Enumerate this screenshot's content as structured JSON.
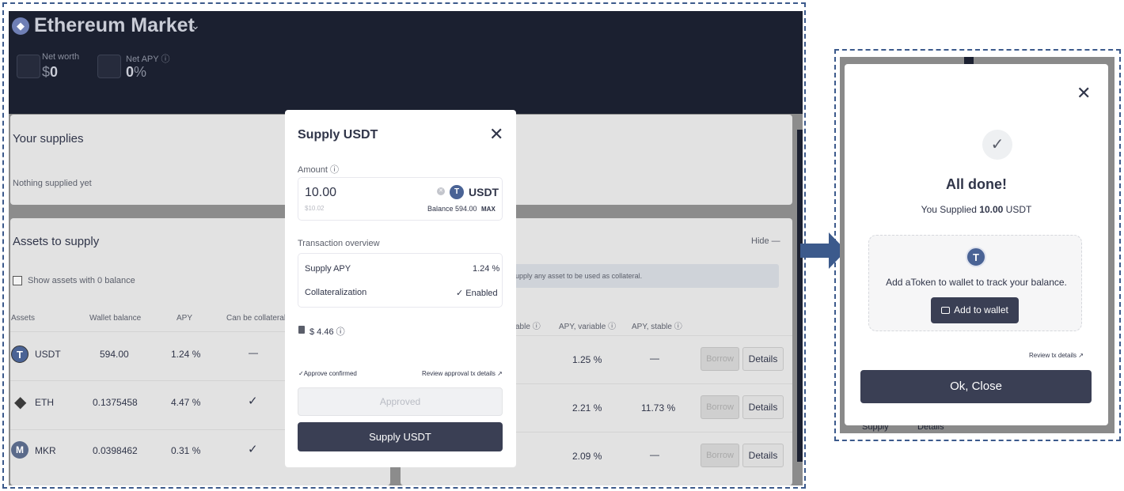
{
  "colors": {
    "dark_header": "#1b2030",
    "button_dark": "#3a3f54",
    "frame": "#3c5a8c",
    "arrow": "#3c5a8c",
    "usdt": "#4a6395",
    "eth": "#3b3b3b",
    "mkr": "#5a6a8a"
  },
  "market": {
    "title": "Ethereum Market",
    "net_worth_label": "Net worth",
    "net_worth_value": "0",
    "net_worth_prefix": "$",
    "net_apy_label": "Net APY",
    "net_apy_value": "0",
    "net_apy_unit": "%"
  },
  "supplies": {
    "title": "Your supplies",
    "empty": "Nothing supplied yet"
  },
  "assets_to_supply": {
    "title": "Assets to supply",
    "show_zero": "Show assets with 0 balance",
    "hide": "Hide —",
    "columns": [
      "Assets",
      "Wallet balance",
      "APY",
      "Can be collateral"
    ],
    "rows": [
      {
        "symbol": "USDT",
        "balance": "594.00",
        "apy": "1.24 %",
        "collateral": "—",
        "icon": "T"
      },
      {
        "symbol": "ETH",
        "balance": "0.1375458",
        "apy": "4.47 %",
        "collateral": "✓",
        "icon": "◆"
      },
      {
        "symbol": "MKR",
        "balance": "0.0398462",
        "apy": "0.31 %",
        "collateral": "✓",
        "icon": "M"
      }
    ]
  },
  "borrow": {
    "notice": "upply any asset to be used as collateral.",
    "columns": [
      "able",
      "APY, variable",
      "APY, stable"
    ],
    "rows": [
      {
        "variable": "1.25 %",
        "stable": "—",
        "borrow": "Borrow",
        "details": "Details"
      },
      {
        "variable": "2.21 %",
        "stable": "11.73 %",
        "borrow": "Borrow",
        "details": "Details"
      },
      {
        "variable": "2.09 %",
        "stable": "—",
        "borrow": "Borrow",
        "details": "Details"
      }
    ]
  },
  "supply_modal": {
    "title": "Supply USDT",
    "amount_label": "Amount",
    "amount_value": "10.00",
    "amount_usd": "$10.02",
    "token": "USDT",
    "balance_text": "Balance 594.00",
    "max": "MAX",
    "overview_label": "Transaction overview",
    "supply_apy_label": "Supply APY",
    "supply_apy_value": "1.24 %",
    "collateral_label": "Collateralization",
    "collateral_value": "Enabled",
    "gas": "$ 4.46",
    "approve_confirmed": "Approve confirmed",
    "review_approval": "Review approval tx details",
    "approved_btn": "Approved",
    "supply_btn": "Supply USDT"
  },
  "done_modal": {
    "title": "All done!",
    "subtitle_prefix": "You Supplied ",
    "subtitle_amount": "10.00",
    "subtitle_suffix": " USDT",
    "add_token_text": "Add aToken to wallet to track your balance.",
    "add_wallet_btn": "Add to wallet",
    "review_tx": "Review tx details",
    "close_btn": "Ok, Close"
  },
  "bg_fragments": {
    "supply": "Supply",
    "details": "Details",
    "ble": "ble"
  }
}
